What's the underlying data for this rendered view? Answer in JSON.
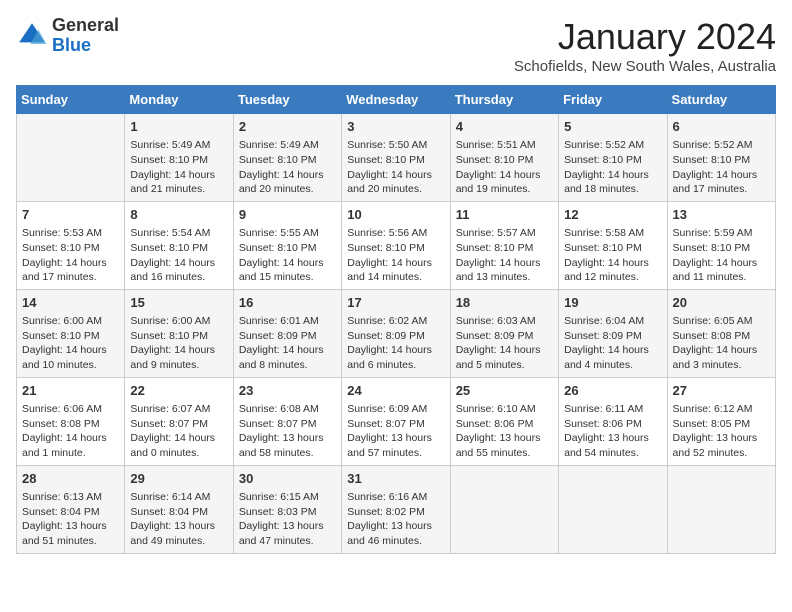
{
  "logo": {
    "general": "General",
    "blue": "Blue"
  },
  "header": {
    "title": "January 2024",
    "subtitle": "Schofields, New South Wales, Australia"
  },
  "weekdays": [
    "Sunday",
    "Monday",
    "Tuesday",
    "Wednesday",
    "Thursday",
    "Friday",
    "Saturday"
  ],
  "weeks": [
    [
      {
        "day": "",
        "info": ""
      },
      {
        "day": "1",
        "info": "Sunrise: 5:49 AM\nSunset: 8:10 PM\nDaylight: 14 hours\nand 21 minutes."
      },
      {
        "day": "2",
        "info": "Sunrise: 5:49 AM\nSunset: 8:10 PM\nDaylight: 14 hours\nand 20 minutes."
      },
      {
        "day": "3",
        "info": "Sunrise: 5:50 AM\nSunset: 8:10 PM\nDaylight: 14 hours\nand 20 minutes."
      },
      {
        "day": "4",
        "info": "Sunrise: 5:51 AM\nSunset: 8:10 PM\nDaylight: 14 hours\nand 19 minutes."
      },
      {
        "day": "5",
        "info": "Sunrise: 5:52 AM\nSunset: 8:10 PM\nDaylight: 14 hours\nand 18 minutes."
      },
      {
        "day": "6",
        "info": "Sunrise: 5:52 AM\nSunset: 8:10 PM\nDaylight: 14 hours\nand 17 minutes."
      }
    ],
    [
      {
        "day": "7",
        "info": "Sunrise: 5:53 AM\nSunset: 8:10 PM\nDaylight: 14 hours\nand 17 minutes."
      },
      {
        "day": "8",
        "info": "Sunrise: 5:54 AM\nSunset: 8:10 PM\nDaylight: 14 hours\nand 16 minutes."
      },
      {
        "day": "9",
        "info": "Sunrise: 5:55 AM\nSunset: 8:10 PM\nDaylight: 14 hours\nand 15 minutes."
      },
      {
        "day": "10",
        "info": "Sunrise: 5:56 AM\nSunset: 8:10 PM\nDaylight: 14 hours\nand 14 minutes."
      },
      {
        "day": "11",
        "info": "Sunrise: 5:57 AM\nSunset: 8:10 PM\nDaylight: 14 hours\nand 13 minutes."
      },
      {
        "day": "12",
        "info": "Sunrise: 5:58 AM\nSunset: 8:10 PM\nDaylight: 14 hours\nand 12 minutes."
      },
      {
        "day": "13",
        "info": "Sunrise: 5:59 AM\nSunset: 8:10 PM\nDaylight: 14 hours\nand 11 minutes."
      }
    ],
    [
      {
        "day": "14",
        "info": "Sunrise: 6:00 AM\nSunset: 8:10 PM\nDaylight: 14 hours\nand 10 minutes."
      },
      {
        "day": "15",
        "info": "Sunrise: 6:00 AM\nSunset: 8:10 PM\nDaylight: 14 hours\nand 9 minutes."
      },
      {
        "day": "16",
        "info": "Sunrise: 6:01 AM\nSunset: 8:09 PM\nDaylight: 14 hours\nand 8 minutes."
      },
      {
        "day": "17",
        "info": "Sunrise: 6:02 AM\nSunset: 8:09 PM\nDaylight: 14 hours\nand 6 minutes."
      },
      {
        "day": "18",
        "info": "Sunrise: 6:03 AM\nSunset: 8:09 PM\nDaylight: 14 hours\nand 5 minutes."
      },
      {
        "day": "19",
        "info": "Sunrise: 6:04 AM\nSunset: 8:09 PM\nDaylight: 14 hours\nand 4 minutes."
      },
      {
        "day": "20",
        "info": "Sunrise: 6:05 AM\nSunset: 8:08 PM\nDaylight: 14 hours\nand 3 minutes."
      }
    ],
    [
      {
        "day": "21",
        "info": "Sunrise: 6:06 AM\nSunset: 8:08 PM\nDaylight: 14 hours\nand 1 minute."
      },
      {
        "day": "22",
        "info": "Sunrise: 6:07 AM\nSunset: 8:07 PM\nDaylight: 14 hours\nand 0 minutes."
      },
      {
        "day": "23",
        "info": "Sunrise: 6:08 AM\nSunset: 8:07 PM\nDaylight: 13 hours\nand 58 minutes."
      },
      {
        "day": "24",
        "info": "Sunrise: 6:09 AM\nSunset: 8:07 PM\nDaylight: 13 hours\nand 57 minutes."
      },
      {
        "day": "25",
        "info": "Sunrise: 6:10 AM\nSunset: 8:06 PM\nDaylight: 13 hours\nand 55 minutes."
      },
      {
        "day": "26",
        "info": "Sunrise: 6:11 AM\nSunset: 8:06 PM\nDaylight: 13 hours\nand 54 minutes."
      },
      {
        "day": "27",
        "info": "Sunrise: 6:12 AM\nSunset: 8:05 PM\nDaylight: 13 hours\nand 52 minutes."
      }
    ],
    [
      {
        "day": "28",
        "info": "Sunrise: 6:13 AM\nSunset: 8:04 PM\nDaylight: 13 hours\nand 51 minutes."
      },
      {
        "day": "29",
        "info": "Sunrise: 6:14 AM\nSunset: 8:04 PM\nDaylight: 13 hours\nand 49 minutes."
      },
      {
        "day": "30",
        "info": "Sunrise: 6:15 AM\nSunset: 8:03 PM\nDaylight: 13 hours\nand 47 minutes."
      },
      {
        "day": "31",
        "info": "Sunrise: 6:16 AM\nSunset: 8:02 PM\nDaylight: 13 hours\nand 46 minutes."
      },
      {
        "day": "",
        "info": ""
      },
      {
        "day": "",
        "info": ""
      },
      {
        "day": "",
        "info": ""
      }
    ]
  ]
}
